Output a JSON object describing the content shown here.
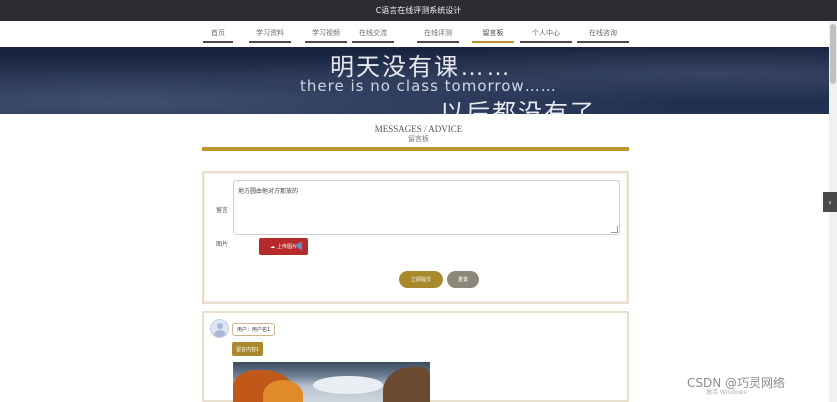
{
  "app": {
    "title": "C语言在线评测系统设计"
  },
  "nav": {
    "items": [
      {
        "label": "首页"
      },
      {
        "label": "学习资料"
      },
      {
        "label": "学习视频"
      },
      {
        "label": "在线交流"
      },
      {
        "label": "在线评测"
      },
      {
        "label": "留言板"
      },
      {
        "label": "个人中心"
      },
      {
        "label": "在线咨询"
      }
    ],
    "active_index": 5
  },
  "banner": {
    "line1": "明天没有课……",
    "line2": "there is no class tomorrow……",
    "line3": "以后都没有了……"
  },
  "section": {
    "title_en": "MESSAGES / ADVICE",
    "title_cn": "留言板"
  },
  "form": {
    "message_label": "留言",
    "message_value": "地方圆由他对方那放的",
    "image_label": "图片",
    "upload_label": "上传图片",
    "submit_label": "立即提交",
    "reset_label": "重置"
  },
  "comments": [
    {
      "user_label": "用户：用户名1",
      "content_label": "留言内容1"
    }
  ],
  "watermark": {
    "text": "CSDN @巧灵网络",
    "sub": "激活 Windows"
  },
  "colors": {
    "accent": "#b9962e",
    "topbar": "#2b2d31",
    "upload": "#b52a2a"
  }
}
